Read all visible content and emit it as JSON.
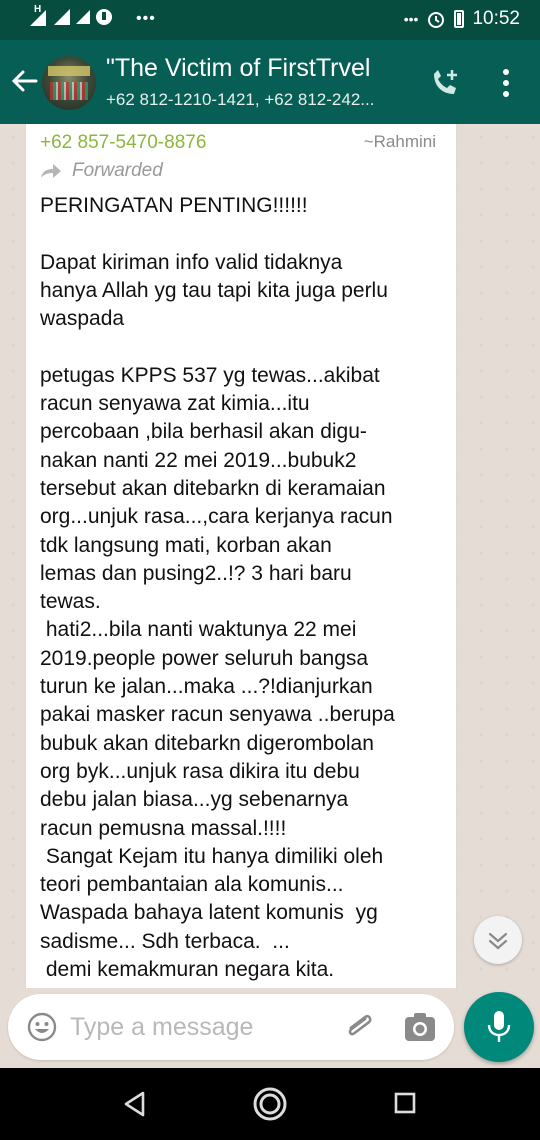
{
  "status_bar": {
    "network_marker": "H",
    "overflow": "•••",
    "time": "10:52"
  },
  "header": {
    "title": "\"The Victim of FirstTrvel",
    "subtitle": "+62 812-1210-1421, +62 812-242..."
  },
  "message": {
    "sender_number": "+62 857-5470-8876",
    "sender_name": "~Rahmini",
    "forwarded_label": "Forwarded",
    "body": "PERINGATAN PENTING!!!!!!\n\nDapat kiriman info valid tidaknya\nhanya Allah yg tau tapi kita juga perlu\nwaspada\n\npetugas KPPS 537 yg tewas...akibat\nracun senyawa zat kimia...itu\npercobaan ,bila berhasil akan digu-\nnakan nanti 22 mei 2019...bubuk2\ntersebut akan ditebarkn di keramaian\norg...unjuk rasa...,cara kerjanya racun\ntdk langsung mati, korban akan\nlemas dan pusing2..!? 3 hari baru\ntewas.\n hati2...bila nanti waktunya 22 mei\n2019.people power seluruh bangsa\nturun ke jalan...maka ...?!dianjurkan\npakai masker racun senyawa ..berupa\nbubuk akan ditebarkn digerombolan\norg byk...unjuk rasa dikira itu debu\ndebu jalan biasa...yg sebenarnya\nracun pemusna massal.!!!!\n Sangat Kejam itu hanya dimiliki oleh\nteori pembantaian ala komunis...\nWaspada bahaya latent komunis  yg\nsadisme... Sdh terbaca.  ...\n demi kemakmuran negara kita."
  },
  "composer": {
    "placeholder": "Type a message"
  },
  "colors": {
    "header": "#075e54",
    "status_bar": "#064d40",
    "accent": "#00897b",
    "sender_name": "#8bb73b",
    "chat_background": "#e5ddd5"
  },
  "icons": {
    "back": "arrow-left-icon",
    "call": "add-call-icon",
    "menu": "more-vert-icon",
    "forward": "forward-arrow-icon",
    "scroll": "chevron-double-down-icon",
    "emoji": "emoji-icon",
    "attach": "paperclip-icon",
    "camera": "camera-icon",
    "mic": "mic-icon"
  }
}
